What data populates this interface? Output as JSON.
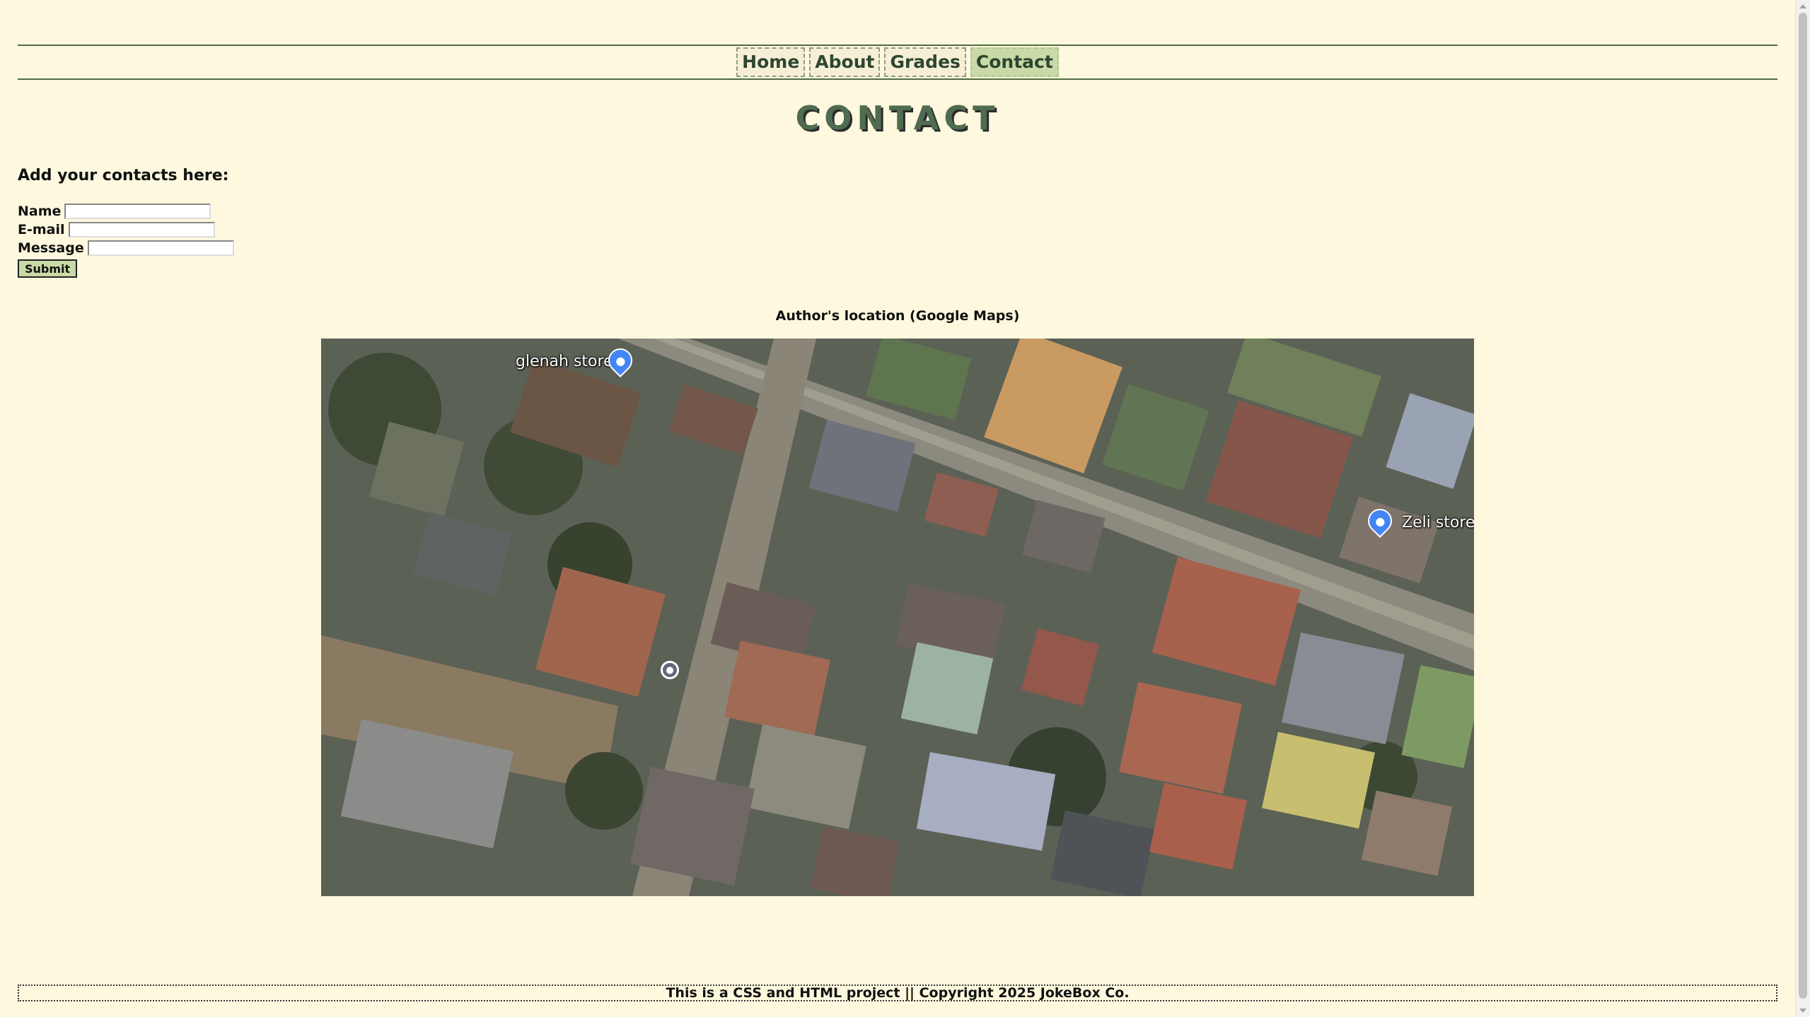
{
  "nav": {
    "items": [
      {
        "label": "Home",
        "active": false
      },
      {
        "label": "About",
        "active": false
      },
      {
        "label": "Grades",
        "active": false
      },
      {
        "label": "Contact",
        "active": true
      }
    ]
  },
  "page": {
    "title": "CONTACT"
  },
  "form": {
    "heading": "Add your contacts here:",
    "name_label": "Name",
    "email_label": "E-mail",
    "message_label": "Message",
    "name_value": "",
    "email_value": "",
    "message_value": "",
    "submit_label": "Submit"
  },
  "map": {
    "caption": "Author's location (Google Maps)",
    "places": [
      {
        "label": "glenah store",
        "icon": "lock-icon"
      },
      {
        "label": "Zeli store",
        "icon": "cart-icon"
      }
    ]
  },
  "footer": {
    "text": "This is a CSS and HTML project || Copyright 2025 JokeBox Co."
  },
  "colors": {
    "background": "#fdf8de",
    "nav_border": "#4f6b3f",
    "accent": "#c9d9a7",
    "title_color": "#4f6b50"
  }
}
